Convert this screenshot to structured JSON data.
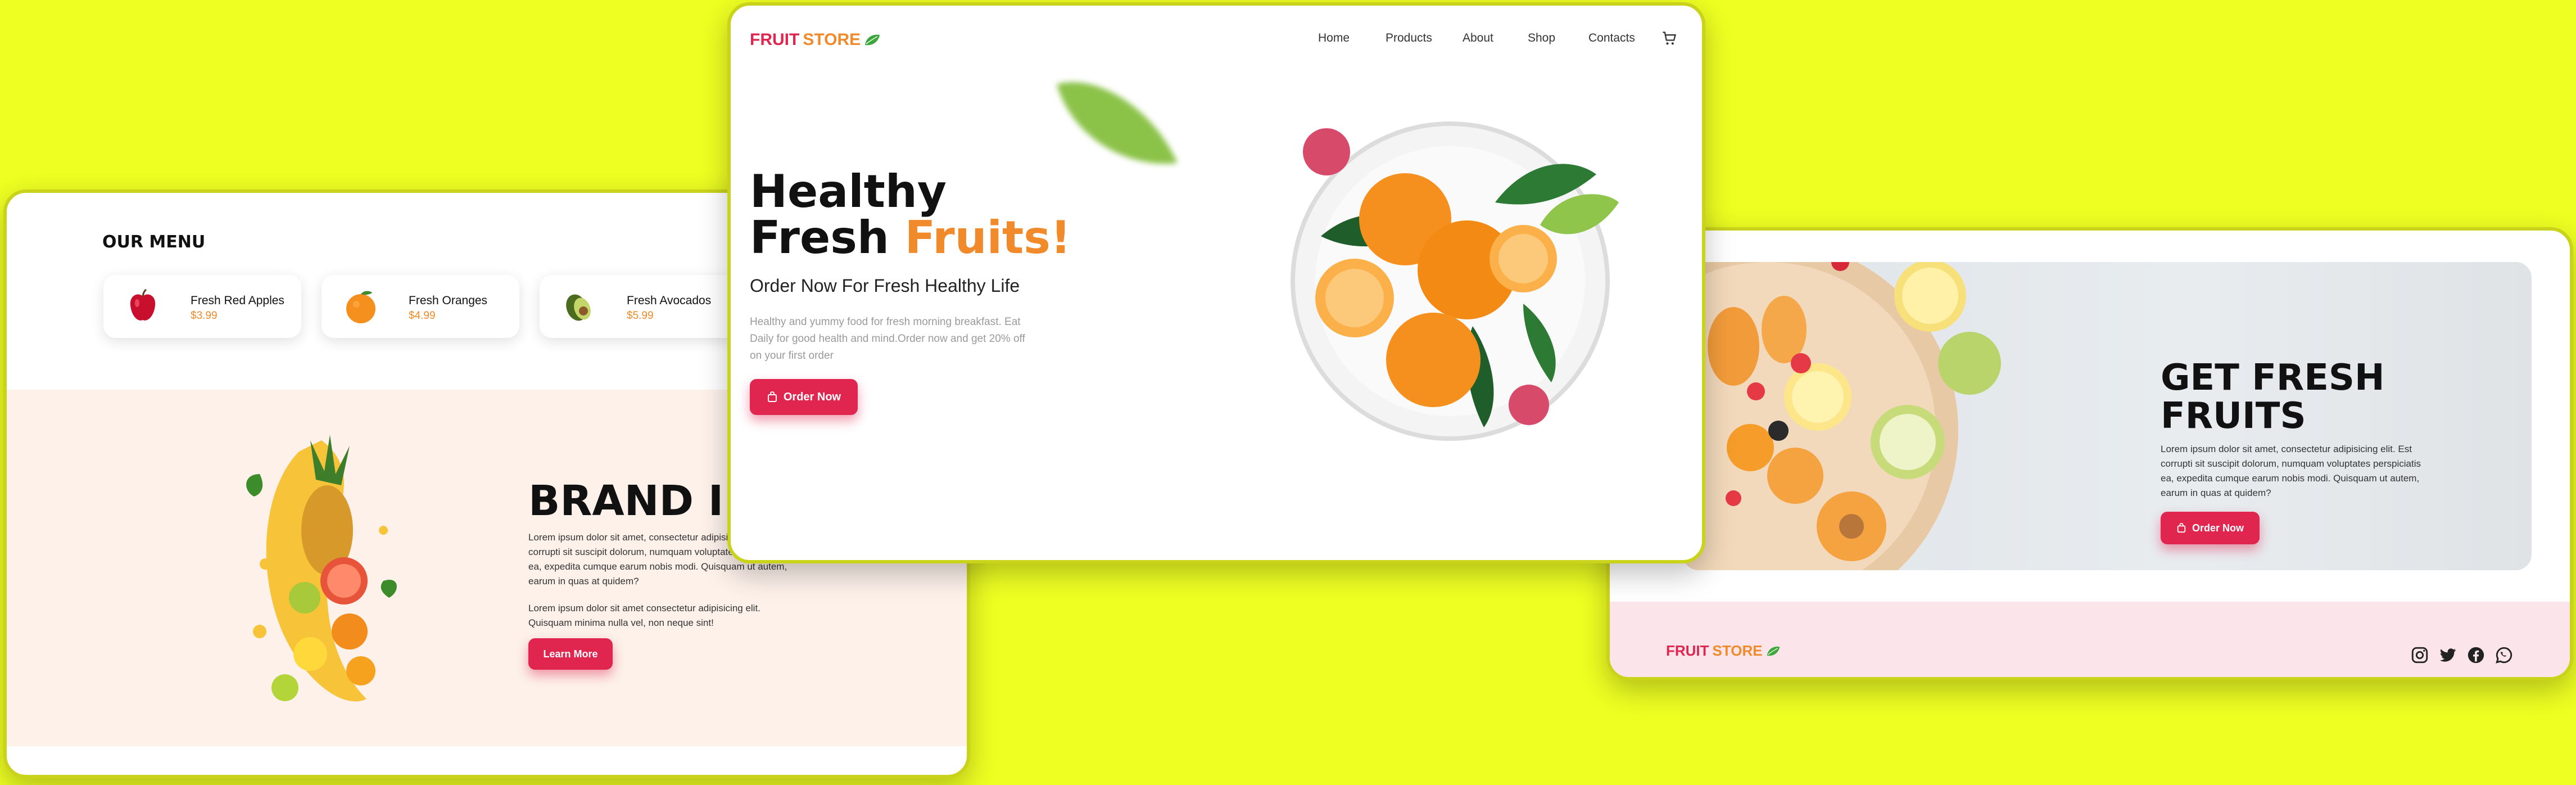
{
  "colors": {
    "background": "#eeff22",
    "primary_red": "#e0264f",
    "accent_orange": "#f08a2a",
    "brand_band": "#fdf1ea",
    "footer_pink": "#fbe4ea"
  },
  "menu_page": {
    "section_title": "OUR MENU",
    "items": [
      {
        "name": "Fresh Red Apples",
        "price": "$3.99",
        "icon": "apple-icon"
      },
      {
        "name": "Fresh Oranges",
        "price": "$4.99",
        "icon": "orange-icon"
      },
      {
        "name": "Fresh Avocados",
        "price": "$5.99",
        "icon": "avocado-icon"
      }
    ],
    "brand_title": "BRAND INF",
    "paragraph_1": "Lorem ipsum dolor sit amet, consectetur adipisicing elit. Est corrupti sit suscipit dolorum, numquam voluptates perspiciatis ea, expedita cumque earum nobis modi. Quisquam ut autem, earum in quas at quidem?",
    "paragraph_2": "Lorem ipsum dolor sit amet consectetur adipisicing elit. Quisquam minima nulla vel, non neque sint!",
    "learn_more": "Learn More"
  },
  "hero_page": {
    "logo_fruit": "FRUIT",
    "logo_store": "STORE",
    "nav": [
      "Home",
      "Products",
      "About",
      "Shop",
      "Contacts"
    ],
    "title_line1": "Healthy",
    "title_line2_a": "Fresh ",
    "title_line2_b": "Fruits!",
    "subtitle": "Order Now For Fresh Healthy Life",
    "description": "Healthy and yummy food for fresh morning breakfast. Eat Daily for good health and mind.Order now and get 20% off on your first order",
    "order_now": "Order Now"
  },
  "promo_page": {
    "banner_title_1": "GET FRESH",
    "banner_title_2": "FRUITS",
    "banner_text": "Lorem ipsum dolor sit amet, consectetur adipisicing elit. Est corrupti sit suscipit dolorum, numquam voluptates perspiciatis ea, expedita cumque earum nobis modi. Quisquam ut autem, earum in quas at quidem?",
    "order_now": "Order Now",
    "footer_logo_fruit": "FRUIT",
    "footer_logo_store": "STORE",
    "social_icons": [
      "instagram-icon",
      "twitter-icon",
      "facebook-icon",
      "whatsapp-icon"
    ]
  }
}
